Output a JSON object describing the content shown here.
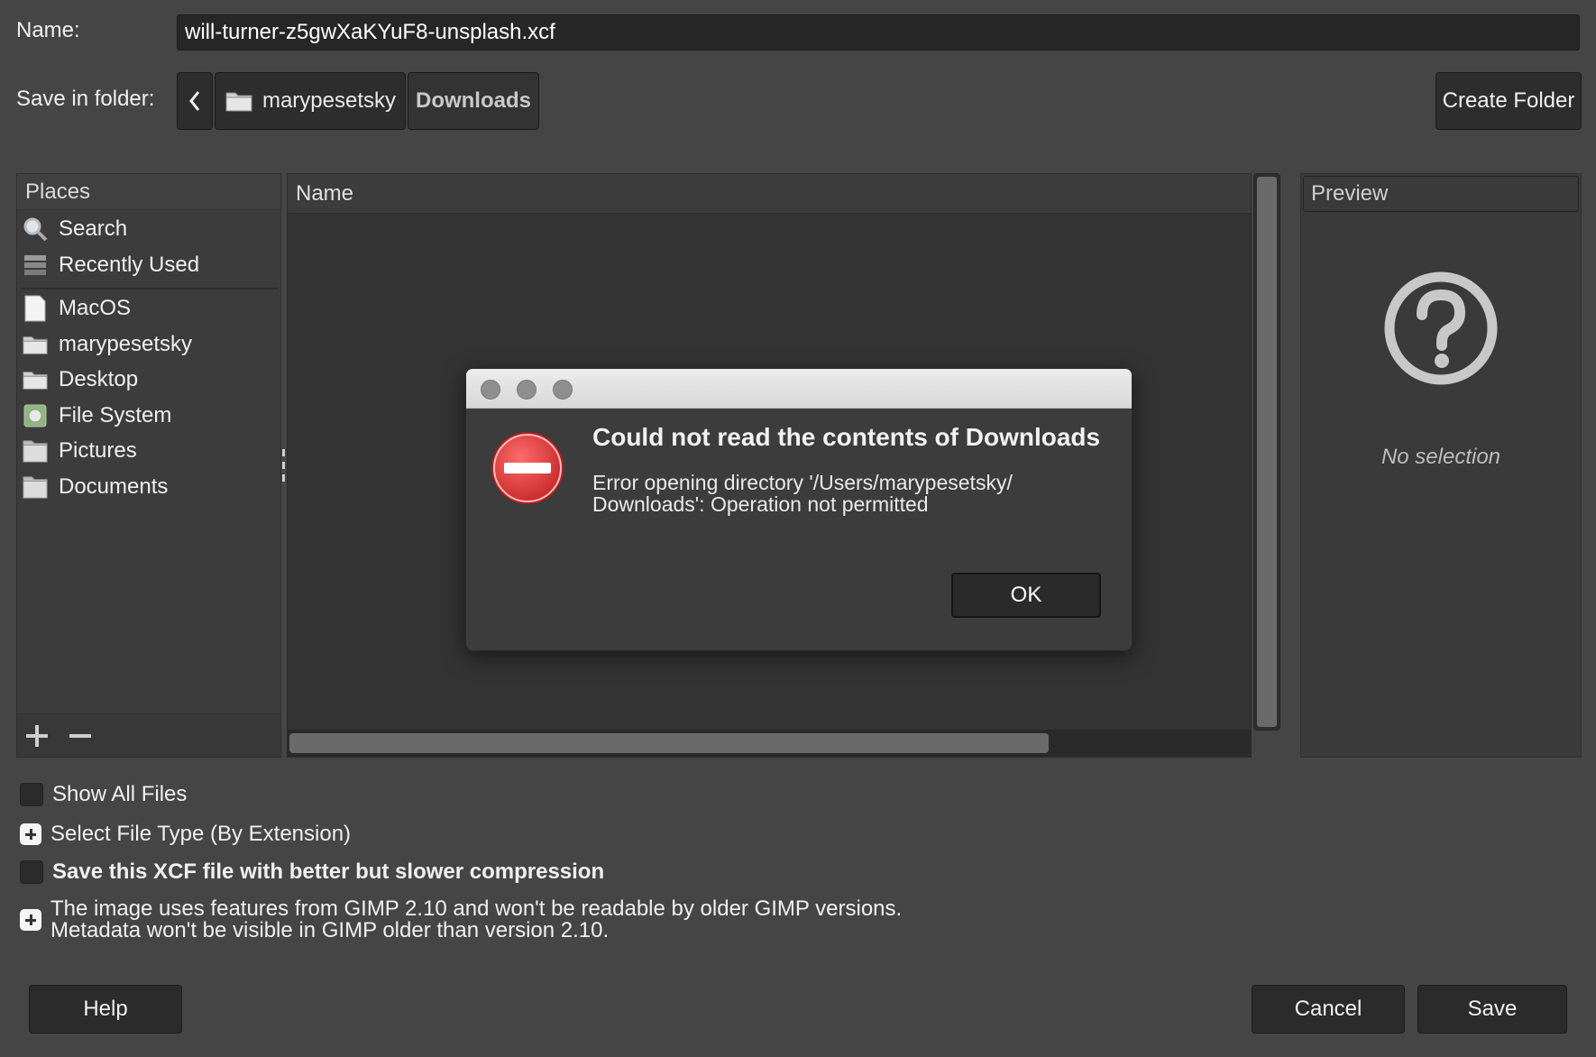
{
  "name_row": {
    "label": "Name:",
    "value": "will-turner-z5gwXaKYuF8-unsplash.xcf"
  },
  "folder_row": {
    "label": "Save in folder:",
    "crumbs": [
      "marypesetsky",
      "Downloads"
    ],
    "create_folder": "Create Folder"
  },
  "places": {
    "header": "Places",
    "items": [
      {
        "label": "Search",
        "icon": "search-icon"
      },
      {
        "label": "Recently Used",
        "icon": "recent-icon"
      },
      {
        "label": "MacOS",
        "icon": "drive-icon"
      },
      {
        "label": "marypesetsky",
        "icon": "folder-icon"
      },
      {
        "label": "Desktop",
        "icon": "folder-icon"
      },
      {
        "label": "File System",
        "icon": "filesystem-icon"
      },
      {
        "label": "Pictures",
        "icon": "folder-icon"
      },
      {
        "label": "Documents",
        "icon": "folder-icon"
      }
    ]
  },
  "filelist": {
    "header": "Name"
  },
  "preview": {
    "header": "Preview",
    "empty_text": "No selection"
  },
  "options": {
    "show_all_files": "Show All Files",
    "select_file_type": "Select File Type (By Extension)",
    "compression": "Save this XCF file with better but slower compression",
    "compat_line1": "The image uses features from GIMP 2.10 and won't be readable by older GIMP versions.",
    "compat_line2": "Metadata won't be visible in GIMP older than version 2.10."
  },
  "buttons": {
    "help": "Help",
    "cancel": "Cancel",
    "save": "Save"
  },
  "error_dialog": {
    "title": "Could not read the contents of Downloads",
    "message_line1": "Error opening directory '/Users/marypesetsky/",
    "message_line2": "Downloads': Operation not permitted",
    "ok": "OK"
  },
  "colors": {
    "background": "#454545",
    "error_red": "#e53935"
  }
}
